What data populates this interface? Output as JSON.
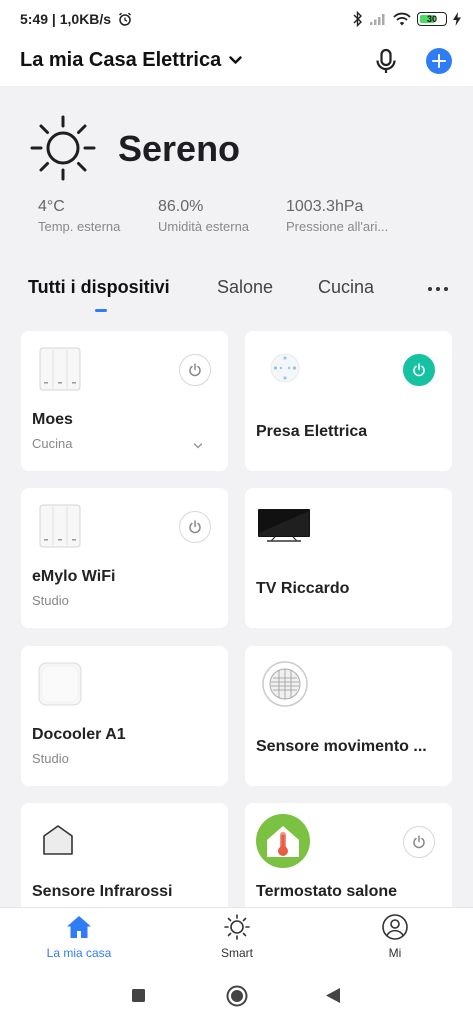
{
  "status_bar": {
    "time": "5:49",
    "speed": "1,0KB/s",
    "battery": "30"
  },
  "header": {
    "home_name": "La mia Casa Elettrica"
  },
  "weather": {
    "condition": "Sereno",
    "metrics": [
      {
        "value": "4°C",
        "label": "Temp. esterna"
      },
      {
        "value": "86.0%",
        "label": "Umidità esterna"
      },
      {
        "value": "1003.3hPa",
        "label": "Pressione all'ari..."
      }
    ]
  },
  "tabs": [
    "Tutti i dispositivi",
    "Salone",
    "Cucina"
  ],
  "devices": [
    {
      "name": "Moes",
      "room": "Cucina"
    },
    {
      "name": "Presa Elettrica"
    },
    {
      "name": "eMylo WiFi",
      "room": "Studio"
    },
    {
      "name": "TV Riccardo"
    },
    {
      "name": "Docooler A1",
      "room": "Studio"
    },
    {
      "name": "Sensore movimento ..."
    },
    {
      "name": "Sensore Infrarossi"
    },
    {
      "name": "Termostato salone"
    }
  ],
  "bottom_nav": [
    "La mia casa",
    "Smart",
    "Mi"
  ],
  "colors": {
    "accent": "#2f7df6",
    "power_on": "#17c2a3",
    "background": "#f2f2f4"
  }
}
